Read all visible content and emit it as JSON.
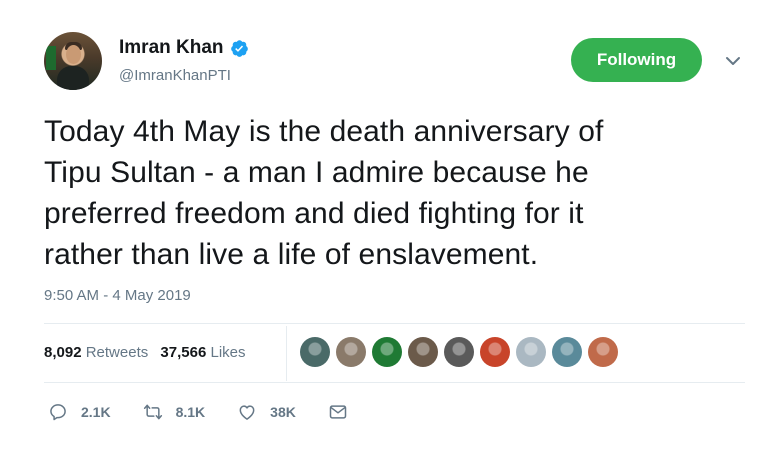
{
  "author": {
    "name": "Imran Khan",
    "handle": "@ImranKhanPTI",
    "verified_icon": "verified-badge-icon"
  },
  "follow_button": {
    "label": "Following",
    "color": "#35b151"
  },
  "more_menu_icon": "chevron-down-icon",
  "tweet": {
    "lines": [
      "Today 4th May is the death anniversary of",
      "Tipu Sultan - a man I admire because he",
      "preferred freedom and died fighting for it",
      "rather than live a life of enslavement."
    ],
    "timestamp": "9:50 AM - 4 May 2019"
  },
  "stats": {
    "retweets_count": "8,092",
    "retweets_label": "Retweets",
    "likes_count": "37,566",
    "likes_label": "Likes"
  },
  "likers": [
    {
      "name": "liker-avatar-1",
      "bg": "#4a6a68"
    },
    {
      "name": "liker-avatar-2",
      "bg": "#8a7a6a"
    },
    {
      "name": "liker-avatar-3",
      "bg": "#1f7a34"
    },
    {
      "name": "liker-avatar-4",
      "bg": "#6b5a4a"
    },
    {
      "name": "liker-avatar-5",
      "bg": "#5a5a5a"
    },
    {
      "name": "liker-avatar-6",
      "bg": "#c8442a"
    },
    {
      "name": "liker-avatar-7",
      "bg": "#aab8c2"
    },
    {
      "name": "liker-avatar-8",
      "bg": "#5a8a9a"
    },
    {
      "name": "liker-avatar-9",
      "bg": "#c06a4a"
    }
  ],
  "actions": {
    "replies": "2.1K",
    "retweets": "8.1K",
    "likes": "38K"
  }
}
